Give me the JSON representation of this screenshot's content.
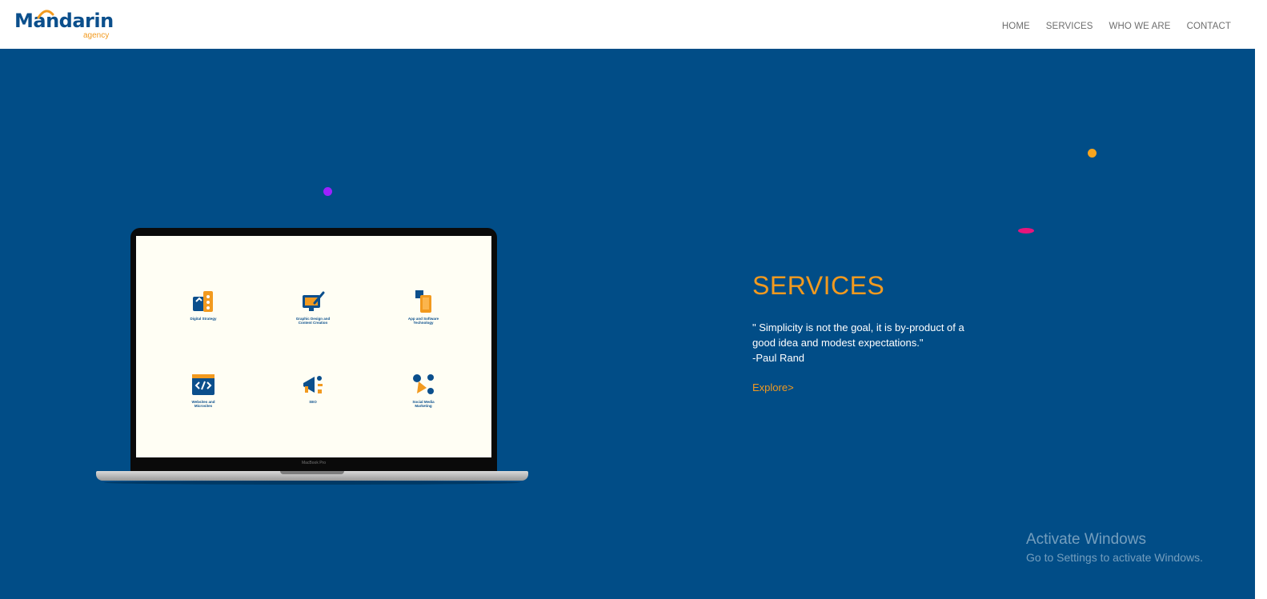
{
  "brand": {
    "name": "Mandarin",
    "tagline": "agency",
    "primary_color": "#0b4f8c",
    "accent_color": "#f29a1f",
    "hero_background": "#014d87"
  },
  "nav": {
    "items": [
      {
        "label": "HOME"
      },
      {
        "label": "SERVICES"
      },
      {
        "label": "WHO WE ARE"
      },
      {
        "label": "CONTACT"
      }
    ]
  },
  "hero": {
    "title": "SERVICES",
    "quote_line1": "\" Simplicity is not the goal, it is by-product of a good idea and modest expectations.\"",
    "quote_author": "-Paul Rand",
    "cta": "Explore>"
  },
  "laptop": {
    "model_label": "MacBook Pro",
    "services": [
      {
        "label_line1": "Digital Strategy",
        "label_line2": "",
        "icon": "digital-strategy-icon"
      },
      {
        "label_line1": "Graphic Design and",
        "label_line2": "Content Creation",
        "icon": "graphic-design-icon"
      },
      {
        "label_line1": "App and Software",
        "label_line2": "Technology",
        "icon": "app-software-icon"
      },
      {
        "label_line1": "Websites and",
        "label_line2": "Microsites",
        "icon": "websites-code-icon"
      },
      {
        "label_line1": "SEO",
        "label_line2": "",
        "icon": "seo-megaphone-icon"
      },
      {
        "label_line1": "Social Media",
        "label_line2": "Marketing",
        "icon": "social-media-icon"
      }
    ]
  },
  "watermark": {
    "title": "Activate Windows",
    "subtitle": "Go to Settings to activate Windows."
  }
}
